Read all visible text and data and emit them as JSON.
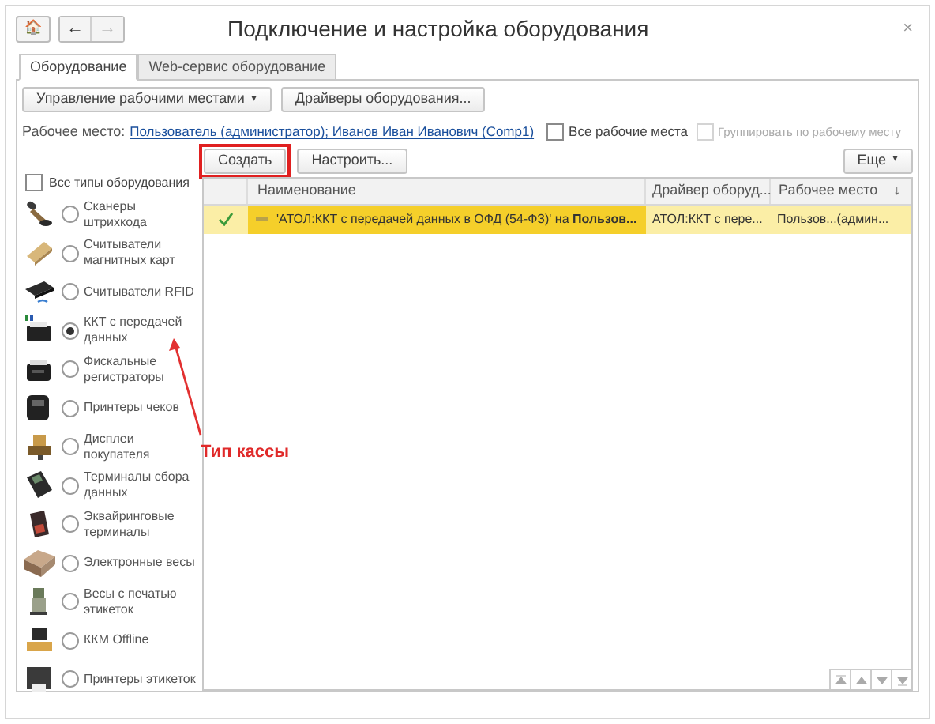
{
  "window": {
    "title": "Подключение и настройка оборудования",
    "close": "×"
  },
  "nav": {
    "home": "🏠",
    "back": "←",
    "forward": "→"
  },
  "tabs": [
    {
      "label": "Оборудование",
      "selected": true
    },
    {
      "label": "Web-сервис оборудование",
      "selected": false
    }
  ],
  "toolbar": {
    "workplaces_menu": "Управление рабочими местами",
    "menu_caret": "▾",
    "drivers": "Драйверы оборудования..."
  },
  "workplace": {
    "label": "Рабочее место:",
    "link": "Пользователь (администратор); Иванов Иван Иванович (Comp1)"
  },
  "all_workplaces": {
    "label": "Все рабочие места",
    "checked": false
  },
  "group_by_workplace": {
    "label": "Группировать по рабочему месту",
    "checked": false,
    "disabled": true
  },
  "actions": {
    "create": "Создать",
    "configure": "Настроить...",
    "more": "Еще",
    "more_caret": "▾"
  },
  "all_types": {
    "label": "Все типы оборудования",
    "checked": false
  },
  "equipment_types": [
    {
      "label": "Сканеры штрихкода",
      "selected": false
    },
    {
      "label": "Считыватели магнитных карт",
      "selected": false
    },
    {
      "label": "Считыватели RFID",
      "selected": false
    },
    {
      "label": "ККТ с передачей данных",
      "selected": true
    },
    {
      "label": "Фискальные регистраторы",
      "selected": false
    },
    {
      "label": "Принтеры чеков",
      "selected": false
    },
    {
      "label": "Дисплеи покупателя",
      "selected": false
    },
    {
      "label": "Терминалы сбора данных",
      "selected": false
    },
    {
      "label": "Эквайринговые терминалы",
      "selected": false
    },
    {
      "label": "Электронные весы",
      "selected": false
    },
    {
      "label": "Весы с печатью этикеток",
      "selected": false
    },
    {
      "label": "ККМ Offline",
      "selected": false
    },
    {
      "label": "Принтеры этикеток",
      "selected": false
    }
  ],
  "table": {
    "columns": [
      "Наименование",
      "Драйвер оборуд...",
      "Рабочее место"
    ],
    "sort_mark": "↓",
    "rows": [
      {
        "active": true,
        "selected": true,
        "name": "'АТОЛ:ККТ с передачей данных в ОФД (54-ФЗ)' на **Пользов...**",
        "driver": "АТОЛ:ККТ с пере...",
        "workplace": "Пользов...(админ..."
      }
    ]
  },
  "annotation": {
    "label": "Тип кассы"
  }
}
